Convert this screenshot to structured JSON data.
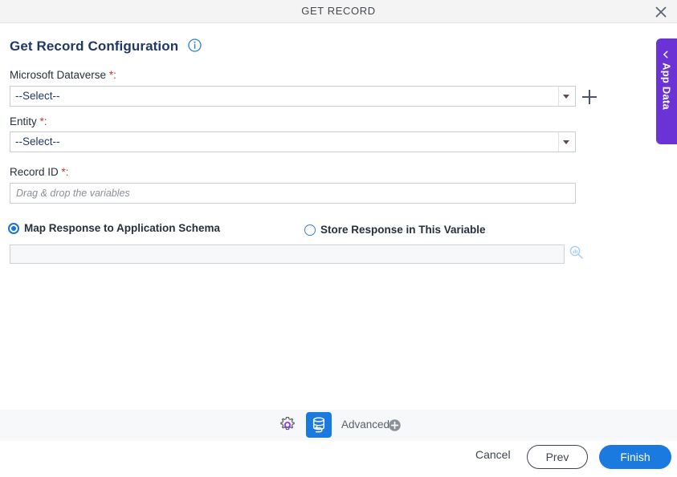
{
  "window": {
    "title": "GET RECORD",
    "close_icon": "close-icon"
  },
  "header": {
    "page_title": "Get Record Configuration",
    "info_icon": "info-icon"
  },
  "form": {
    "dataverse": {
      "label": "Microsoft Dataverse",
      "required_marker": "*:",
      "value": "--Select--",
      "add_icon": "plus-icon"
    },
    "entity": {
      "label": "Entity",
      "required_marker": "*:",
      "value": "--Select--"
    },
    "record_id": {
      "label": "Record ID",
      "required_marker": "*:",
      "value": "",
      "placeholder": "Drag & drop the variables"
    },
    "response_option": {
      "map_label": "Map Response to Application Schema",
      "store_label": "Store Response in This Variable",
      "selected": "map"
    },
    "schema_field": {
      "value": "",
      "search_icon": "search-icon"
    }
  },
  "app_data_tab": {
    "label": "App Data",
    "chevron_icon": "chevron-left-icon"
  },
  "toolbar": {
    "gear_icon": "gear-icon",
    "database_icon": "database-refresh-icon",
    "advanced_label": "Advanced",
    "advanced_add_icon": "plus-circle-icon"
  },
  "footer": {
    "cancel_label": "Cancel",
    "prev_label": "Prev",
    "finish_label": "Finish"
  },
  "colors": {
    "accent_blue": "#1a7ae0",
    "purple": "#6b32d6",
    "required_red": "#c0392b",
    "title_navy": "#1f3864"
  }
}
